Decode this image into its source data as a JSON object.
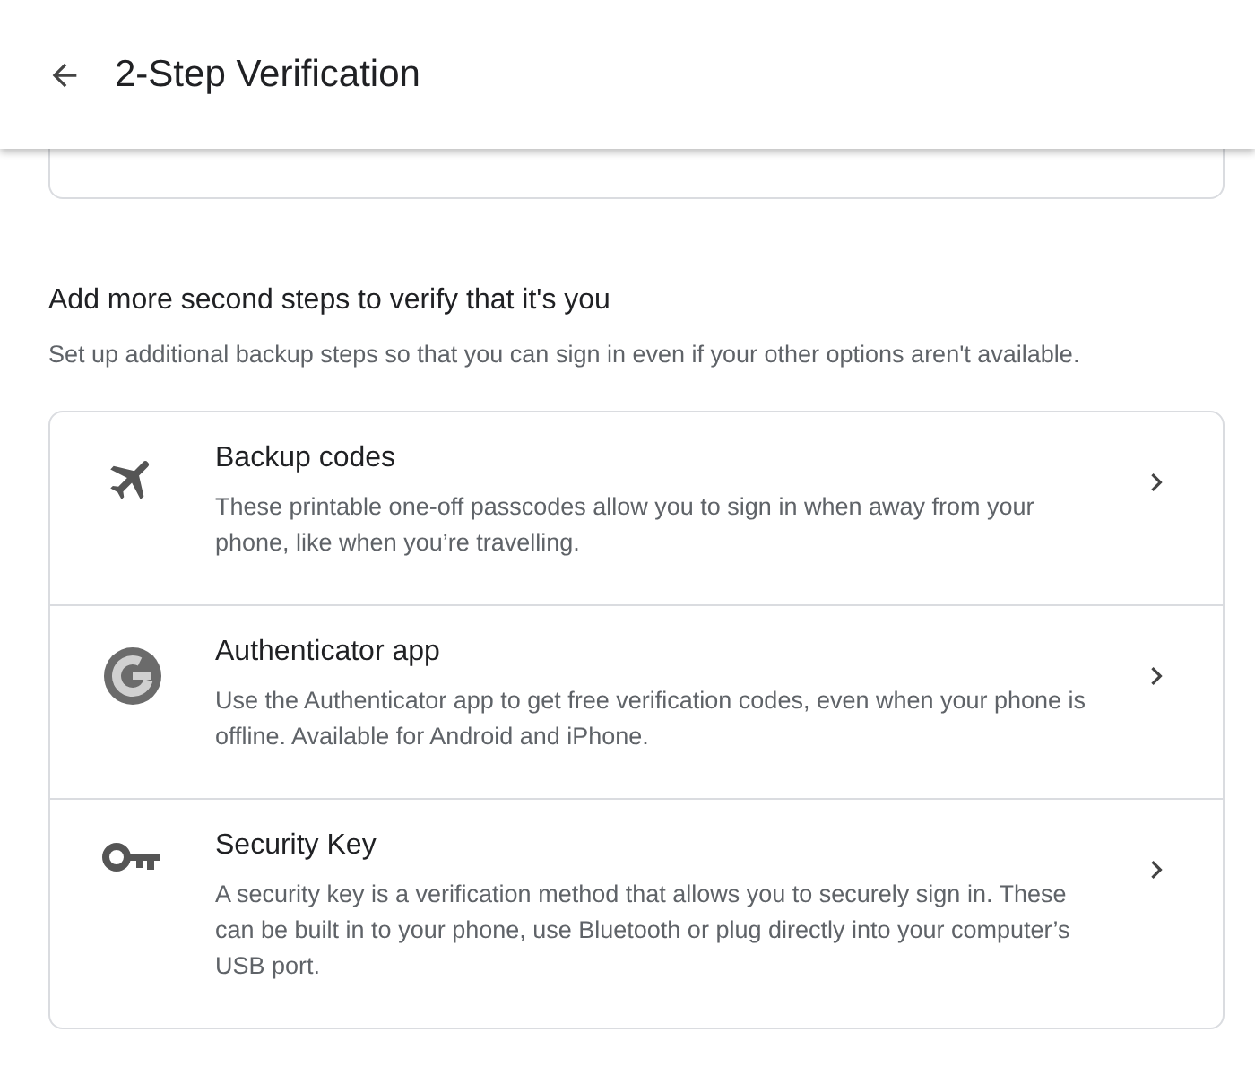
{
  "header": {
    "title": "2-Step Verification"
  },
  "section": {
    "heading": "Add more second steps to verify that it's you",
    "subtitle": "Set up additional backup steps so that you can sign in even if your other options aren't available."
  },
  "options": [
    {
      "kind": "plane",
      "title": "Backup codes",
      "description": "These printable one-off passcodes allow you to sign in when away from your phone, like when you’re travelling."
    },
    {
      "kind": "authenticator",
      "title": "Authenticator app",
      "description": "Use the Authenticator app to get free verification codes, even when your phone is offline. Available for Android and iPhone."
    },
    {
      "kind": "key",
      "title": "Security Key",
      "description": "A security key is a verification method that allows you to securely sign in. These can be built in to your phone, use Bluetooth or plug directly into your computer’s USB port."
    }
  ]
}
